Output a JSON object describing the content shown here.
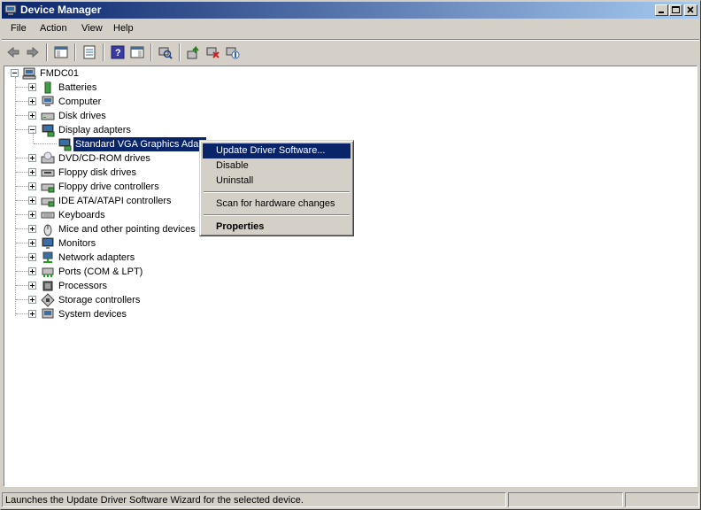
{
  "window": {
    "title": "Device Manager"
  },
  "menubar": {
    "items": [
      "File",
      "Action",
      "View",
      "Help"
    ]
  },
  "toolbar": {
    "icons": [
      "back-icon",
      "forward-icon",
      "console-tree-icon",
      "properties-list-icon",
      "help-icon",
      "action-pane-icon",
      "scan-hardware-icon",
      "update-driver-icon",
      "uninstall-icon",
      "disable-icon"
    ]
  },
  "tree": {
    "root": "FMDC01",
    "categories": [
      "Batteries",
      "Computer",
      "Disk drives",
      "Display adapters",
      "DVD/CD-ROM drives",
      "Floppy disk drives",
      "Floppy drive controllers",
      "IDE ATA/ATAPI controllers",
      "Keyboards",
      "Mice and other pointing devices",
      "Monitors",
      "Network adapters",
      "Ports (COM & LPT)",
      "Processors",
      "Storage controllers",
      "System devices"
    ],
    "expanded_child": "Standard VGA Graphics Adap"
  },
  "context_menu": {
    "update": "Update Driver Software...",
    "disable": "Disable",
    "uninstall": "Uninstall",
    "scan": "Scan for hardware changes",
    "properties": "Properties"
  },
  "status": {
    "text": "Launches the Update Driver Software Wizard for the selected device."
  },
  "colors": {
    "titlebar": "#0a246a",
    "selection": "#0a246a",
    "chrome": "#d4d0c8"
  }
}
